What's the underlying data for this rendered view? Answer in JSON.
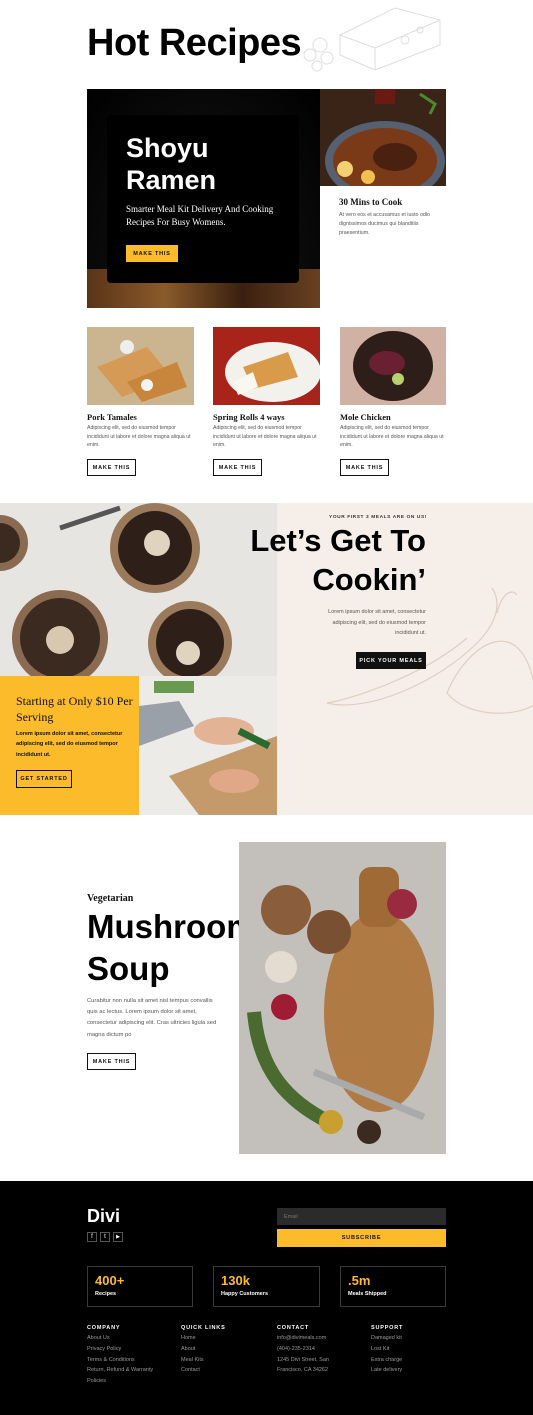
{
  "hero": {
    "title": "Hot Recipes",
    "feature": {
      "title_line1": "Shoyu",
      "title_line2": "Ramen",
      "subtitle": "Smarter Meal Kit Delivery And Cooking Recipes For Busy Womens.",
      "button": "MAKE THIS"
    },
    "side": {
      "title": "30 Mins to Cook",
      "text": "At vero eos et accusamus et iusto odio dignissimos ducimus qui blanditiis praesentium."
    }
  },
  "recipes": [
    {
      "title": "Pork Tamales",
      "text": "Adipiscing elit, sed do eiusmod tempor incididunt ut labore et dolore magna aliqua ut enim.",
      "button": "MAKE THIS"
    },
    {
      "title": "Spring Rolls 4 ways",
      "text": "Adipiscing elit, sed do eiusmod tempor incididunt ut labore et dolore magna aliqua ut enim.",
      "button": "MAKE THIS"
    },
    {
      "title": "Mole Chicken",
      "text": "Adipiscing elit, sed do eiusmod tempor incididunt ut labore et dolore magna aliqua ut enim.",
      "button": "MAKE THIS"
    }
  ],
  "cookin": {
    "eyebrow": "YOUR FIRST 3 MEALS ARE ON US!",
    "title_line1": "Let’s Get To",
    "title_line2": "Cookin’",
    "text": "Lorem ipsum dolor sit amet, consectetur adipiscing elit, sed do eiusmod tempor incididunt ut.",
    "button": "PICK YOUR MEALS"
  },
  "promo": {
    "title": "Starting at Only $10 Per Serving",
    "text": "Lorem ipsum dolor sit amet, consectetur adipiscing elit, sed do eiusmod tempor incididunt ut.",
    "button": "GET STARTED"
  },
  "soup": {
    "eyebrow": "Vegetarian",
    "title_line1": "Mushroom",
    "title_line2": "Soup",
    "text": "Curabitur non nulla sit amet nisl tempus convallis quis ac lectus. Lorem ipsum dolor sit amet, consectetur adipiscing elit. Cras ultricies ligula sed magna dictum po",
    "button": "MAKE THIS"
  },
  "footer": {
    "logo": "Divi",
    "social": [
      "f",
      "t",
      "▶"
    ],
    "email_placeholder": "Email",
    "subscribe": "SUBSCRIBE",
    "stats": [
      {
        "value": "400+",
        "label": "Recipes"
      },
      {
        "value": "130k",
        "label": "Happy Customers"
      },
      {
        "value": ".5m",
        "label": "Meals Shipped"
      }
    ],
    "columns": [
      {
        "heading": "COMPANY",
        "links": [
          "About Us",
          "Privacy Policy",
          "Terms & Conditions",
          "Return, Refund & Warranty",
          "Policies"
        ]
      },
      {
        "heading": "QUICK LINKS",
        "links": [
          "Home",
          "About",
          "Meal Kits",
          "Contact"
        ]
      },
      {
        "heading": "CONTACT",
        "links": [
          "info@divimeals.com",
          "(404)-235-2314",
          "1245 Divi Street, San",
          "Francisco, CA 34262"
        ]
      },
      {
        "heading": "SUPPORT",
        "links": [
          "Damaged kit",
          "Lost Kit",
          "Extra charge",
          "Late delivery"
        ]
      }
    ]
  },
  "colors": {
    "accent": "#fbbb2a",
    "dark": "#000000",
    "cream": "#f6eee8"
  }
}
